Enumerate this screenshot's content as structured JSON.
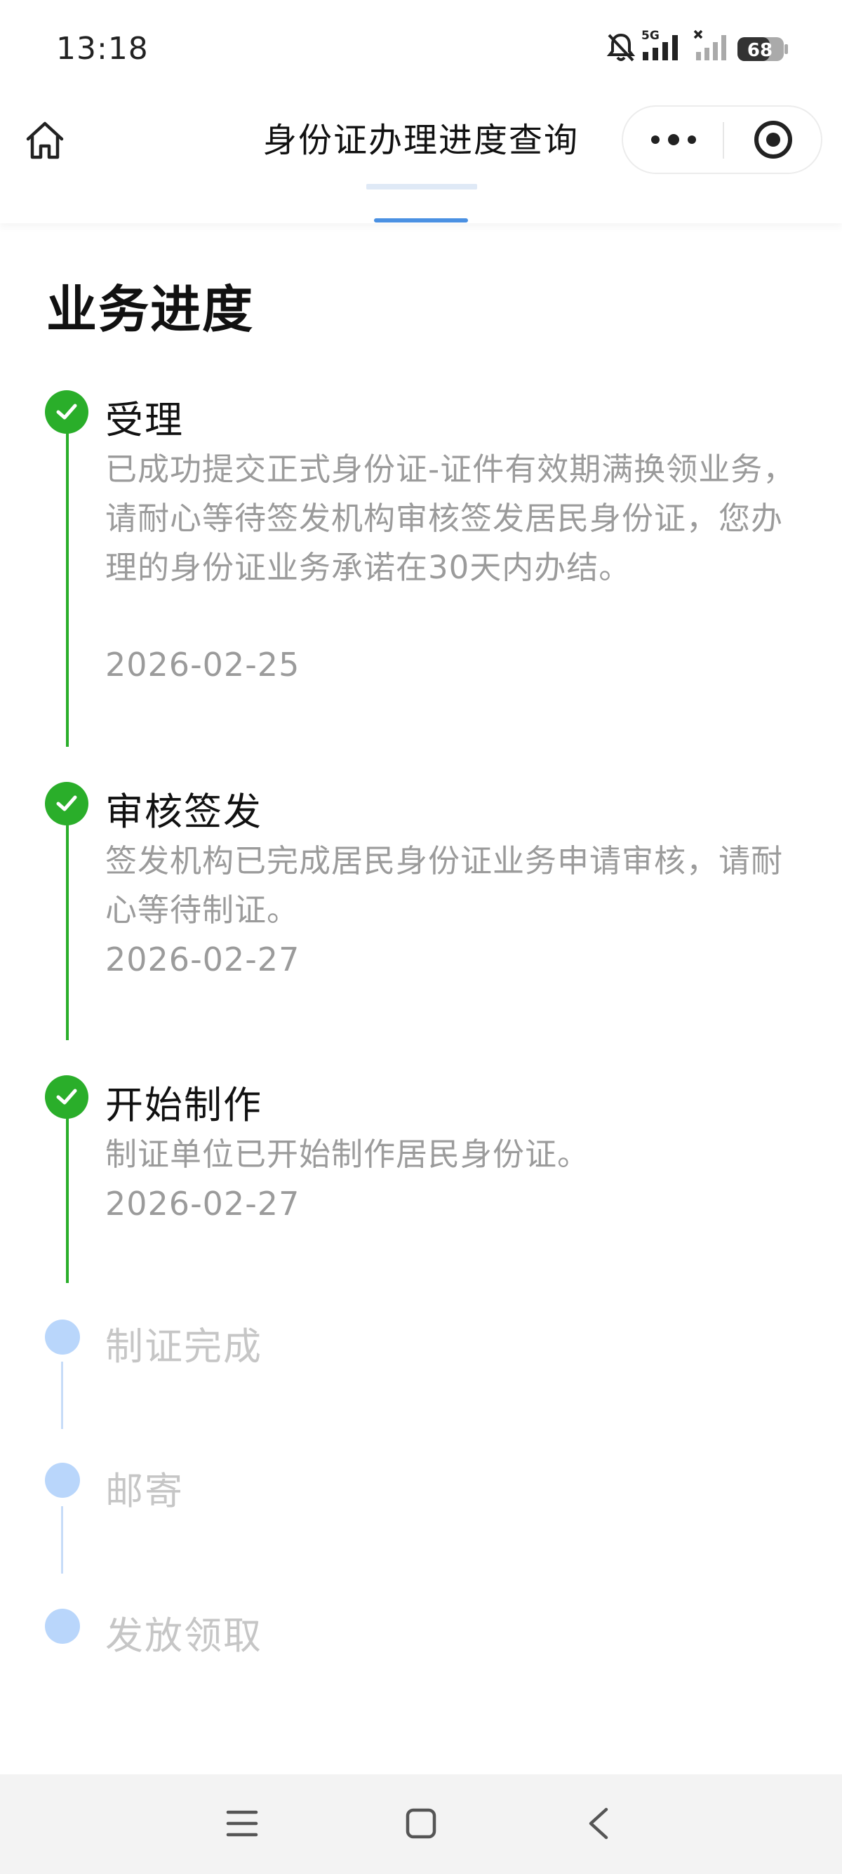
{
  "status_bar": {
    "time": "13:18",
    "network": "5G",
    "battery": "68"
  },
  "nav": {
    "title": "身份证办理进度查询"
  },
  "progress": {
    "title": "业务进度",
    "steps": [
      {
        "title": "受理",
        "desc": "已成功提交正式身份证-证件有效期满换领业务，请耐心等待签发机构审核签发居民身份证，您办理的身份证业务承诺在30天内办结。",
        "date": "2026-02-25",
        "status": "done"
      },
      {
        "title": "审核签发",
        "desc": "签发机构已完成居民身份证业务申请审核，请耐心等待制证。",
        "date": "2026-02-27",
        "status": "done"
      },
      {
        "title": "开始制作",
        "desc": "制证单位已开始制作居民身份证。",
        "date": "2026-02-27",
        "status": "done"
      },
      {
        "title": "制证完成",
        "status": "pending"
      },
      {
        "title": "邮寄",
        "status": "pending"
      },
      {
        "title": "发放领取",
        "status": "pending"
      }
    ]
  },
  "colors": {
    "done": "#2aae2a",
    "pending": "#b9d6fb",
    "accent": "#4a90e2"
  },
  "icons": {
    "home": "home-icon",
    "more": "more-dots-icon",
    "close": "target-close-icon",
    "check": "check-icon",
    "menu": "menu-icon",
    "square": "square-home-icon",
    "back": "back-chevron-icon"
  }
}
